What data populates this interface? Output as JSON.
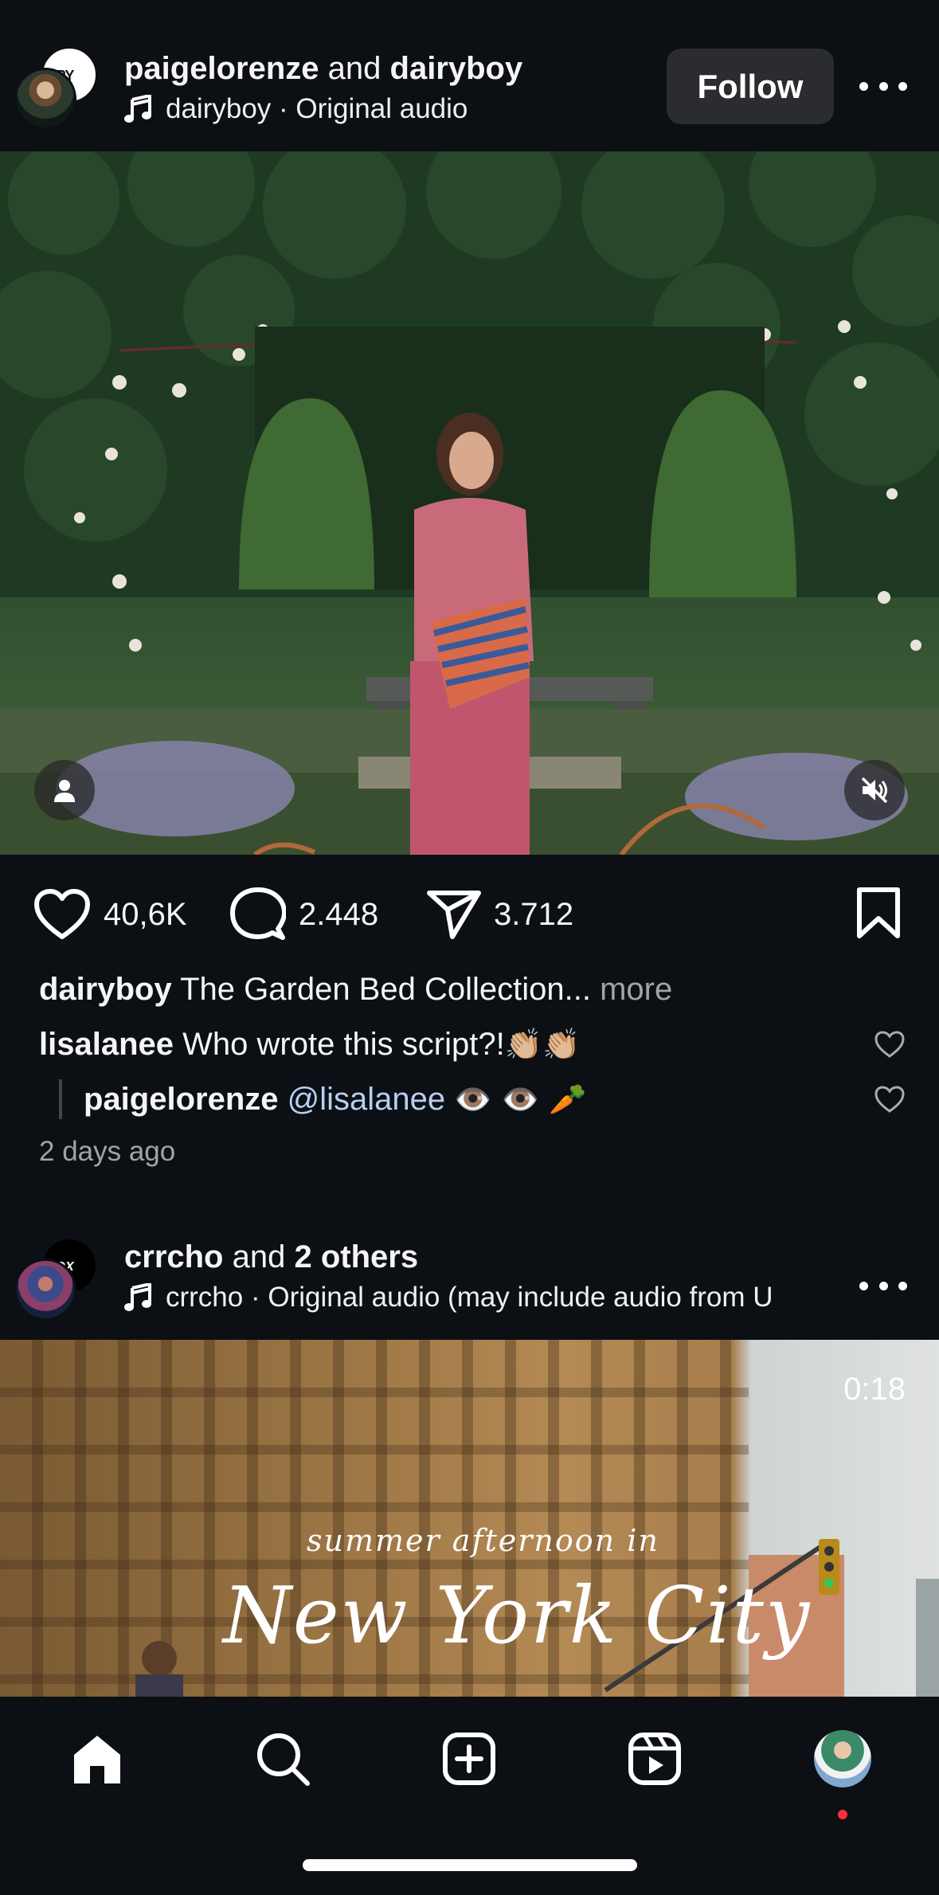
{
  "post1": {
    "header": {
      "user1": "paigelorenze",
      "joiner": "and",
      "user2": "dairyboy",
      "audio_text": "dairyboy · Original audio",
      "follow_label": "Follow",
      "back_avatar_text": "RY"
    },
    "actions": {
      "likes": "40,6K",
      "comments": "2.448",
      "shares": "3.712"
    },
    "caption": {
      "user": "dairyboy",
      "text": "The Garden Bed Collection...",
      "more": "more"
    },
    "comments": [
      {
        "user": "lisalanee",
        "text": "Who wrote this script?!",
        "emoji": "👏🏼👏🏼"
      },
      {
        "user": "paigelorenze",
        "mention": "@lisalanee",
        "emoji": "👁️ 👁️ 🥕"
      }
    ],
    "timestamp": "2 days ago"
  },
  "post2": {
    "header": {
      "user1": "crrcho",
      "joiner": "and",
      "user2": "2 others",
      "audio_text": "crrcho · Original audio  (may include audio from U",
      "back_avatar_text": "ROX"
    },
    "video": {
      "time_left": "0:18",
      "overlay_small": "summer afternoon in",
      "overlay_big": "New York City"
    }
  },
  "colors": {
    "background": "#0c0f14",
    "text": "#f5f5f5",
    "muted": "#a0a3a8",
    "mention": "#b8cff0",
    "follow_bg": "#2a2c30",
    "notification_dot": "#ff2d3b"
  },
  "nav": {
    "items": [
      "home-icon",
      "search-icon",
      "create-icon",
      "reels-icon",
      "profile-avatar"
    ]
  }
}
